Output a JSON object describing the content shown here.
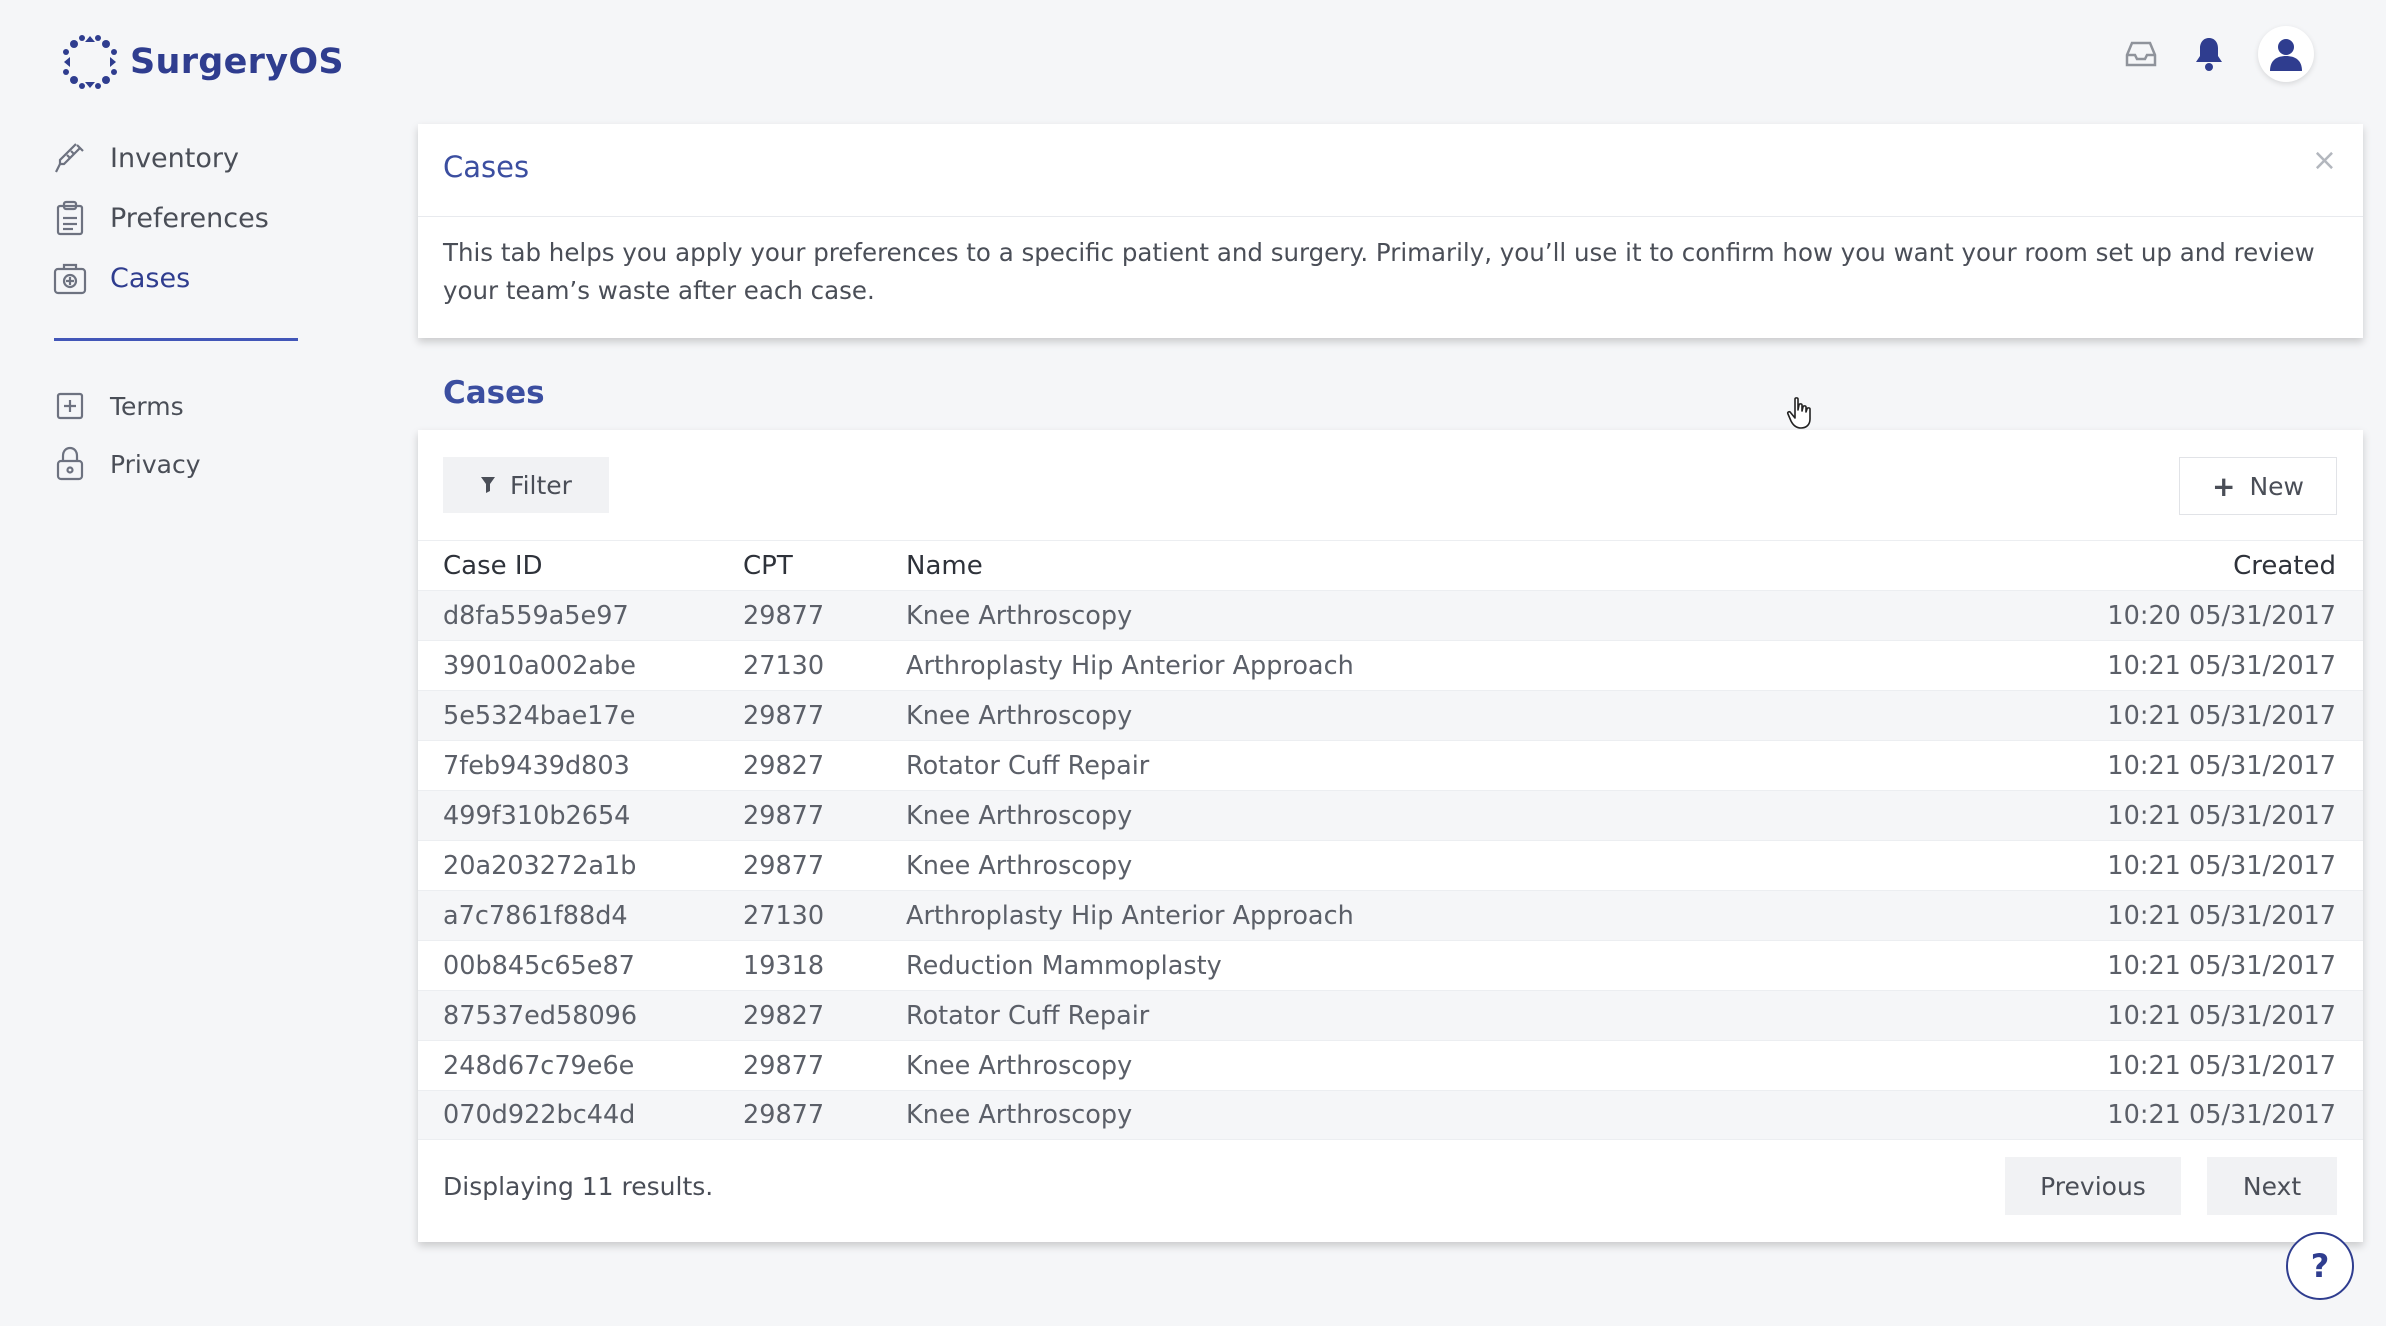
{
  "app": {
    "name": "SurgeryOS"
  },
  "colors": {
    "brand": "#2f3d8f",
    "accent": "#4256b8",
    "background": "#f5f6f8"
  },
  "header": {
    "icons": [
      "inbox-icon",
      "bell-icon",
      "user-avatar-icon"
    ]
  },
  "sidebar": {
    "items": [
      {
        "label": "Inventory",
        "icon": "syringe-icon",
        "active": false
      },
      {
        "label": "Preferences",
        "icon": "clipboard-icon",
        "active": false
      },
      {
        "label": "Cases",
        "icon": "case-icon",
        "active": true
      }
    ],
    "secondary": [
      {
        "label": "Terms",
        "icon": "document-icon"
      },
      {
        "label": "Privacy",
        "icon": "lock-icon"
      }
    ]
  },
  "info_card": {
    "title": "Cases",
    "close": "×",
    "text": "This tab helps you apply your preferences to a specific patient and surgery. Primarily, you’ll use it to confirm how you want your room set up and review your team’s waste after each case."
  },
  "cases": {
    "section_title": "Cases",
    "filter_label": "Filter",
    "new_label": "New",
    "columns": {
      "id": "Case ID",
      "cpt": "CPT",
      "name": "Name",
      "created": "Created"
    },
    "rows": [
      {
        "id": "d8fa559a5e97",
        "cpt": "29877",
        "name": "Knee Arthroscopy",
        "created": "10:20 05/31/2017"
      },
      {
        "id": "39010a002abe",
        "cpt": "27130",
        "name": "Arthroplasty Hip Anterior Approach",
        "created": "10:21 05/31/2017"
      },
      {
        "id": "5e5324bae17e",
        "cpt": "29877",
        "name": "Knee Arthroscopy",
        "created": "10:21 05/31/2017"
      },
      {
        "id": "7feb9439d803",
        "cpt": "29827",
        "name": "Rotator Cuff Repair",
        "created": "10:21 05/31/2017"
      },
      {
        "id": "499f310b2654",
        "cpt": "29877",
        "name": "Knee Arthroscopy",
        "created": "10:21 05/31/2017"
      },
      {
        "id": "20a203272a1b",
        "cpt": "29877",
        "name": "Knee Arthroscopy",
        "created": "10:21 05/31/2017"
      },
      {
        "id": "a7c7861f88d4",
        "cpt": "27130",
        "name": "Arthroplasty Hip Anterior Approach",
        "created": "10:21 05/31/2017"
      },
      {
        "id": "00b845c65e87",
        "cpt": "19318",
        "name": "Reduction Mammoplasty",
        "created": "10:21 05/31/2017"
      },
      {
        "id": "87537ed58096",
        "cpt": "29827",
        "name": "Rotator Cuff Repair",
        "created": "10:21 05/31/2017"
      },
      {
        "id": "248d67c79e6e",
        "cpt": "29877",
        "name": "Knee Arthroscopy",
        "created": "10:21 05/31/2017"
      },
      {
        "id": "070d922bc44d",
        "cpt": "29877",
        "name": "Knee Arthroscopy",
        "created": "10:21 05/31/2017"
      }
    ],
    "footer_text": "Displaying 11 results.",
    "prev_label": "Previous",
    "next_label": "Next"
  },
  "help": {
    "label": "?"
  }
}
